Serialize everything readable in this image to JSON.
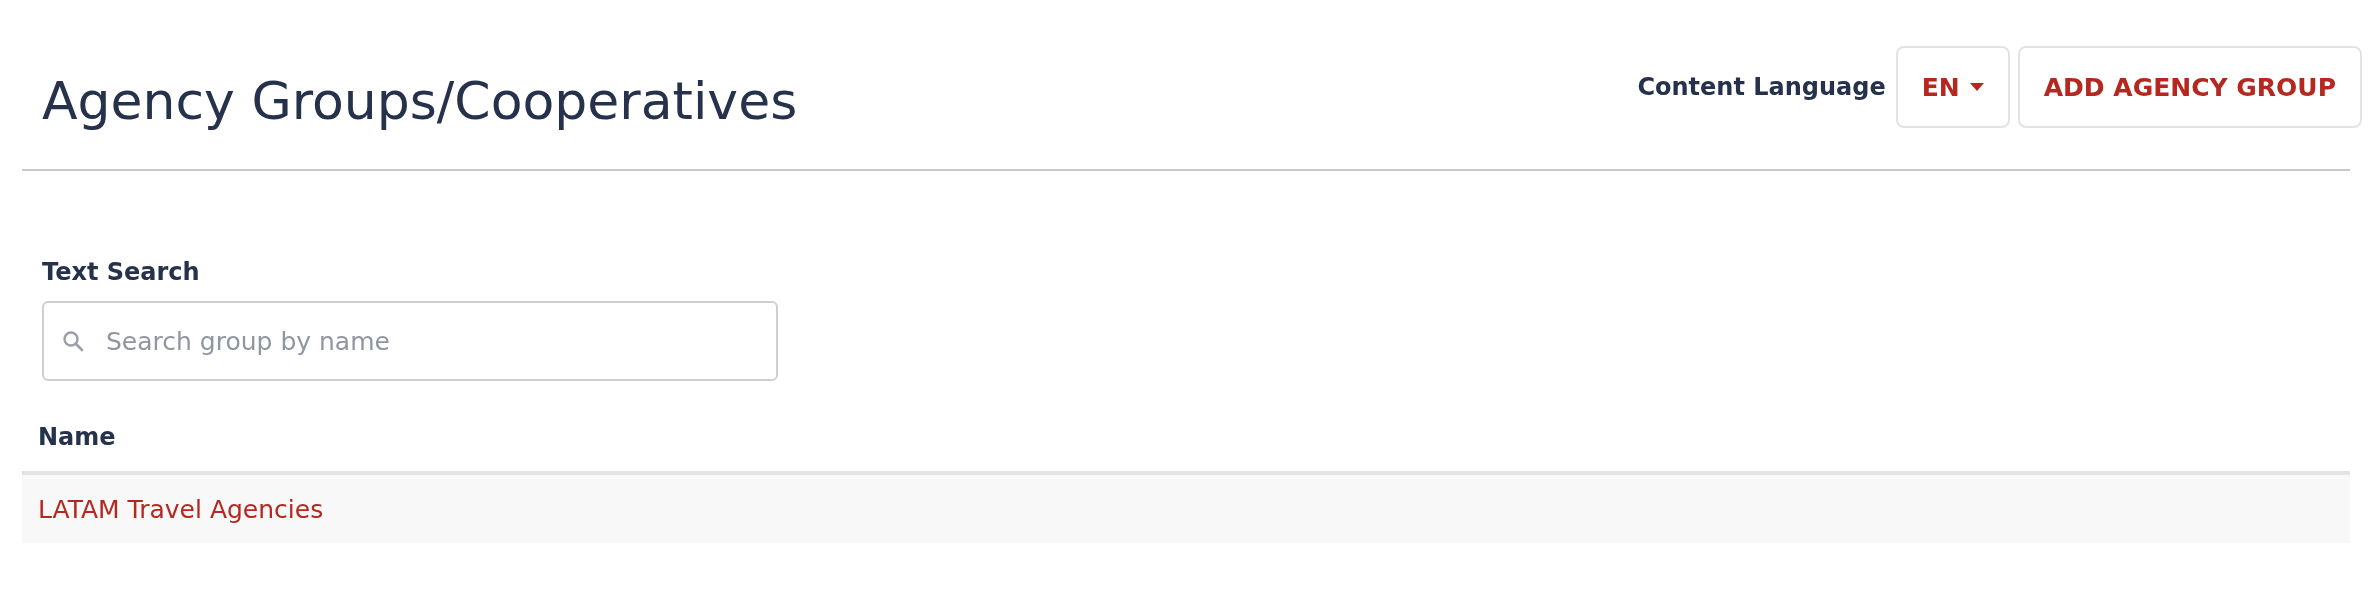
{
  "page_title": "Agency Groups/Cooperatives",
  "content_language": {
    "label": "Content Language",
    "value": "EN"
  },
  "add_button": "ADD AGENCY GROUP",
  "search": {
    "label": "Text Search",
    "placeholder": "Search group by name"
  },
  "table": {
    "columns": [
      "Name"
    ],
    "rows": [
      {
        "name": "LATAM Travel Agencies"
      }
    ]
  }
}
